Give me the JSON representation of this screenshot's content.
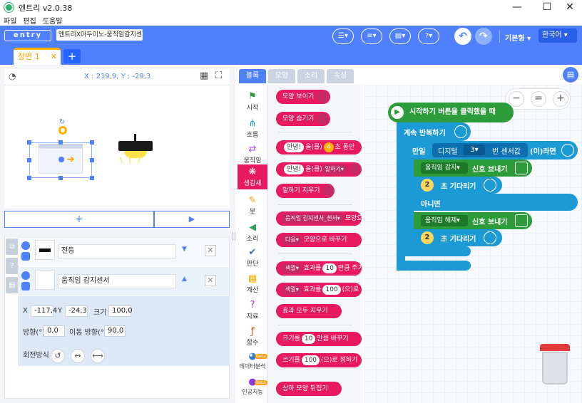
{
  "window": {
    "title": "엔트리 v2.0.38",
    "minimize": "—",
    "maximize": "☐",
    "close": "✕"
  },
  "menu": [
    "파일",
    "편집",
    "도움말"
  ],
  "header": {
    "logo": "entry",
    "project_name": "엔트리X아두이노-움직임감지센서",
    "mode_label": "기본형",
    "language": "한국어"
  },
  "scene": {
    "tab_label": "장면 1",
    "close": "✕",
    "add": "+"
  },
  "stage": {
    "coords": "X : 219,9, Y : -29,3",
    "add_object": "+",
    "start": "▶"
  },
  "objects": [
    {
      "name": "전등"
    },
    {
      "name": "움직임 감지센서"
    }
  ],
  "properties": {
    "x_label": "X",
    "x_value": "-117,4",
    "y_label": "Y",
    "y_value": "-24,3",
    "size_label": "크기",
    "size_value": "100,0",
    "direction_label": "방향(°)",
    "direction_value": "0,0",
    "move_direction_label": "이동 방향(°)",
    "move_direction_value": "90,0",
    "rotation_label": "회전방식"
  },
  "palette_tabs": [
    "블록",
    "모양",
    "소리",
    "속성"
  ],
  "categories": [
    {
      "label": "시작",
      "icon": "flag-icon"
    },
    {
      "label": "흐름",
      "icon": "flow-icon"
    },
    {
      "label": "움직임",
      "icon": "move-icon"
    },
    {
      "label": "생김새",
      "icon": "looks-icon"
    },
    {
      "label": "붓",
      "icon": "brush-icon"
    },
    {
      "label": "소리",
      "icon": "sound-icon"
    },
    {
      "label": "판단",
      "icon": "judge-icon"
    },
    {
      "label": "계산",
      "icon": "calc-icon"
    },
    {
      "label": "자료",
      "icon": "data-icon"
    },
    {
      "label": "함수",
      "icon": "function-icon"
    },
    {
      "label": "데이터분석",
      "icon": "analysis-icon"
    },
    {
      "label": "인공지능",
      "icon": "ai-icon"
    }
  ],
  "beta": "Beta",
  "blocks": {
    "b1": "모양 보이기",
    "b2": "모양 숨기기",
    "b3a": "안녕!",
    "b3b": "을(를)",
    "b3c": "4",
    "b3d": "초 동안",
    "b4a": "안녕!",
    "b4b": "을(를)",
    "b4c": "말하기▾",
    "b5": "말하기 지우기",
    "b6a": "움직임 감지센서_센서▾",
    "b6b": "모양으",
    "b7a": "다음▾",
    "b7b": "모양으로 바꾸기",
    "b8a": "색깔▾",
    "b8b": "효과를",
    "b8c": "10",
    "b8d": "만큼 주기",
    "b9a": "색깔▾",
    "b9b": "효과를",
    "b9c": "100",
    "b9d": "(으)로 정",
    "b10": "효과 모두 지우기",
    "b11a": "크기를",
    "b11b": "10",
    "b11c": "만큼 바꾸기",
    "b12a": "크기를",
    "b12b": "100",
    "b12c": "(으)로 정하기",
    "b13": "상하 모양 뒤집기"
  },
  "script": {
    "start": "시작하기 버튼을 클릭했을 때",
    "loop": "계속 반복하기",
    "if": "만일",
    "digital": "디지털",
    "pin": "3▾",
    "sensor_value": "번 센서값",
    "then": "(이)라면",
    "msg1": "움직임 감지▾",
    "send1": "신호 보내기",
    "wait1_val": "2",
    "wait1": "초 기다리기",
    "else": "아니면",
    "msg2": "움직임 해제▾",
    "send2": "신호 보내기",
    "wait2_val": "2",
    "wait2": "초 기다리기"
  },
  "zoom": {
    "out": "−",
    "reset": "=",
    "in": "+"
  },
  "colors": {
    "header": "#4f80ff",
    "looks": "#e8195f",
    "flow": "#1b9ad6",
    "start": "#2c9c3a"
  }
}
